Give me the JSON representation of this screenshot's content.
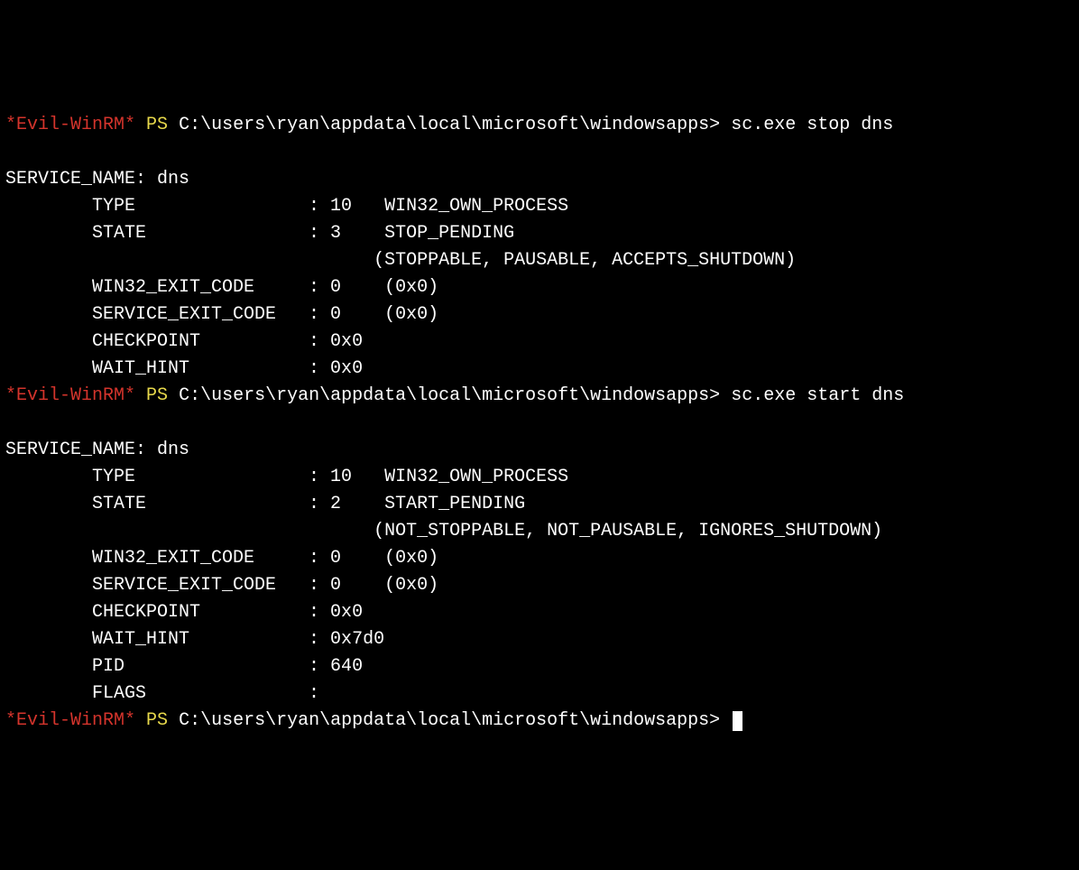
{
  "prompt": {
    "prefix": "*Evil-WinRM*",
    "ps": "PS",
    "path": "C:\\users\\ryan\\appdata\\local\\microsoft\\windowsapps>"
  },
  "blocks": [
    {
      "command": "sc.exe stop dns",
      "service_name_label": "SERVICE_NAME:",
      "service_name_value": "dns",
      "fields": [
        {
          "label": "TYPE",
          "code": "10",
          "value": "WIN32_OWN_PROCESS"
        },
        {
          "label": "STATE",
          "code": "3",
          "value": "STOP_PENDING",
          "detail": "(STOPPABLE, PAUSABLE, ACCEPTS_SHUTDOWN)"
        },
        {
          "label": "WIN32_EXIT_CODE",
          "code": "0",
          "value": "(0x0)"
        },
        {
          "label": "SERVICE_EXIT_CODE",
          "code": "0",
          "value": "(0x0)"
        },
        {
          "label": "CHECKPOINT",
          "code": "0x0",
          "value": ""
        },
        {
          "label": "WAIT_HINT",
          "code": "0x0",
          "value": ""
        }
      ]
    },
    {
      "command": "sc.exe start dns",
      "service_name_label": "SERVICE_NAME:",
      "service_name_value": "dns",
      "fields": [
        {
          "label": "TYPE",
          "code": "10",
          "value": "WIN32_OWN_PROCESS"
        },
        {
          "label": "STATE",
          "code": "2",
          "value": "START_PENDING",
          "detail": "(NOT_STOPPABLE, NOT_PAUSABLE, IGNORES_SHUTDOWN)"
        },
        {
          "label": "WIN32_EXIT_CODE",
          "code": "0",
          "value": "(0x0)"
        },
        {
          "label": "SERVICE_EXIT_CODE",
          "code": "0",
          "value": "(0x0)"
        },
        {
          "label": "CHECKPOINT",
          "code": "0x0",
          "value": ""
        },
        {
          "label": "WAIT_HINT",
          "code": "0x7d0",
          "value": ""
        },
        {
          "label": "PID",
          "code": "640",
          "value": ""
        },
        {
          "label": "FLAGS",
          "code": "",
          "value": ""
        }
      ]
    }
  ],
  "final_prompt_command": ""
}
